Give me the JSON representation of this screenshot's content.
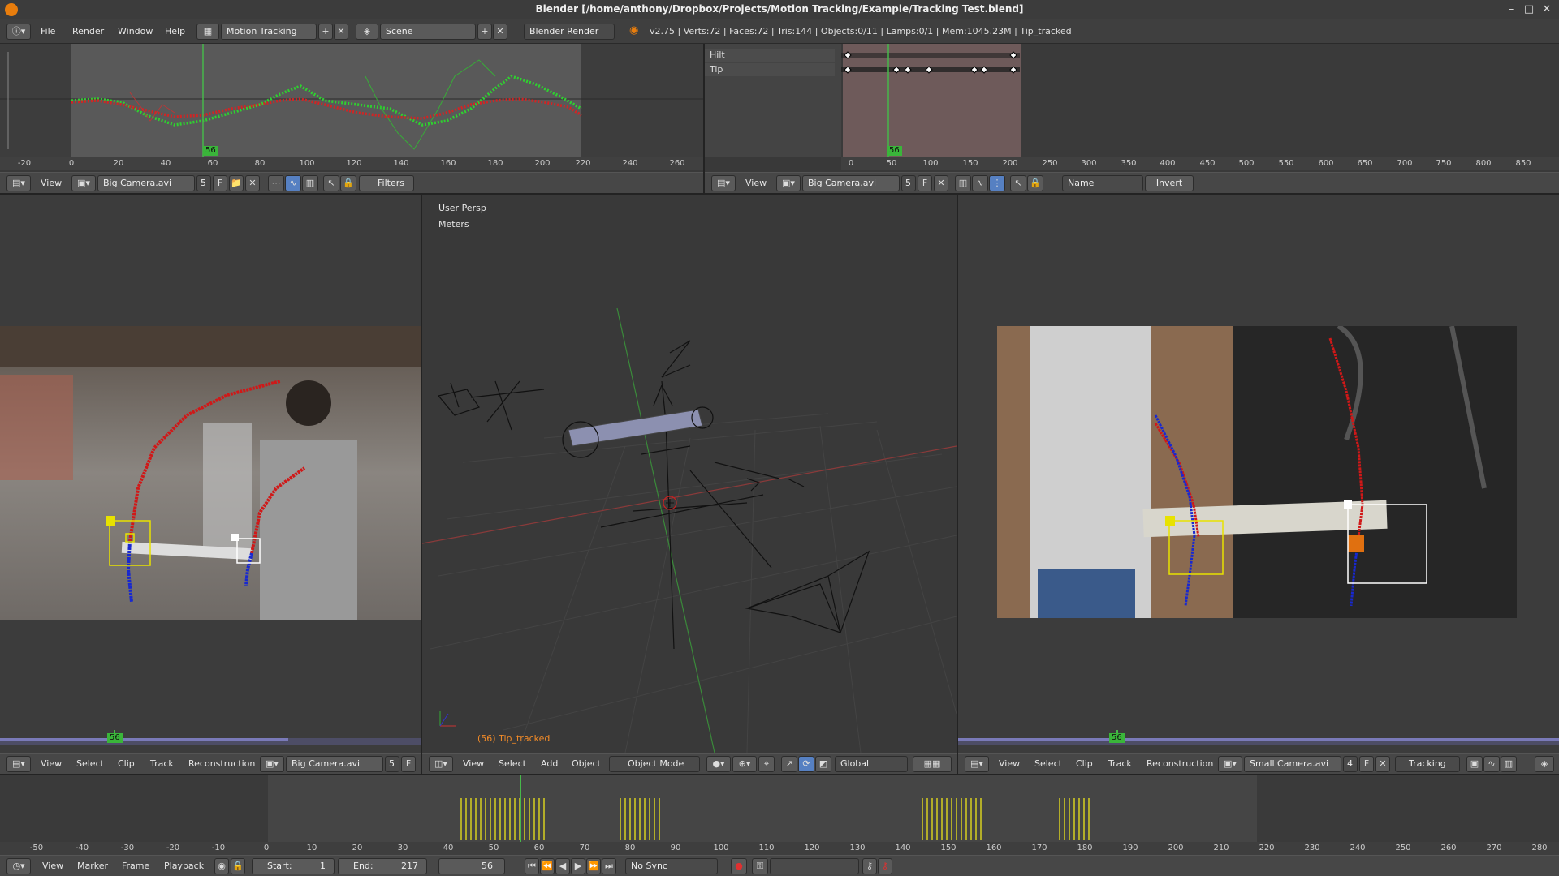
{
  "window": {
    "title": "Blender [/home/anthony/Dropbox/Projects/Motion Tracking/Example/Tracking Test.blend]",
    "minimize": "–",
    "maximize": "□",
    "close": "✕"
  },
  "info_bar": {
    "menus": [
      "File",
      "Render",
      "Window",
      "Help"
    ],
    "screen_layout": "Motion Tracking",
    "scene": "Scene",
    "render_engine": "Blender Render",
    "stats": "v2.75 | Verts:72 | Faces:72 | Tris:144 | Objects:0/11 | Lamps:0/1 | Mem:1045.23M | Tip_tracked"
  },
  "graph_editor": {
    "ruler_ticks": [
      "-20",
      "0",
      "20",
      "40",
      "60",
      "80",
      "100",
      "120",
      "140",
      "160",
      "180",
      "200",
      "220",
      "240",
      "260"
    ],
    "current_frame": "56",
    "header": {
      "view": "View",
      "clip": "Big Camera.avi",
      "users": "5",
      "f": "F",
      "filters": "Filters"
    }
  },
  "dopesheet": {
    "channels": [
      "Hilt",
      "Tip"
    ],
    "ruler_ticks": [
      "0",
      "50",
      "100",
      "150",
      "200",
      "250",
      "300",
      "350",
      "400",
      "450",
      "500",
      "550",
      "600",
      "650",
      "700",
      "750",
      "800",
      "850"
    ],
    "current_frame": "56",
    "header": {
      "view": "View",
      "clip": "Big Camera.avi",
      "users": "5",
      "f": "F",
      "sort": "Name",
      "invert": "Invert"
    }
  },
  "clip_left": {
    "current_frame": "56",
    "header": {
      "menus": [
        "View",
        "Select",
        "Clip",
        "Track",
        "Reconstruction"
      ],
      "clip": "Big Camera.avi",
      "users": "5",
      "f": "F"
    }
  },
  "viewport": {
    "overlay_persp": "User Persp",
    "overlay_units": "Meters",
    "object_label": "(56) Tip_tracked",
    "header": {
      "menus": [
        "View",
        "Select",
        "Add",
        "Object"
      ],
      "mode": "Object Mode",
      "orientation": "Global"
    }
  },
  "clip_right": {
    "current_frame": "56",
    "header": {
      "menus": [
        "View",
        "Select",
        "Clip",
        "Track",
        "Reconstruction"
      ],
      "clip": "Small Camera.avi",
      "users": "4",
      "f": "F",
      "mode": "Tracking"
    }
  },
  "timeline": {
    "ruler_ticks": [
      "-50",
      "-40",
      "-30",
      "-20",
      "-10",
      "0",
      "10",
      "20",
      "30",
      "40",
      "50",
      "60",
      "70",
      "80",
      "90",
      "100",
      "110",
      "120",
      "130",
      "140",
      "150",
      "160",
      "170",
      "180",
      "190",
      "200",
      "210",
      "220",
      "230",
      "240",
      "250",
      "260",
      "270",
      "280"
    ],
    "header": {
      "menus": [
        "View",
        "Marker",
        "Frame",
        "Playback"
      ],
      "start": "Start:",
      "start_val": "1",
      "end": "End:",
      "end_val": "217",
      "current": "56",
      "sync": "No Sync"
    }
  },
  "colors": {
    "accent": "#5680c2",
    "frame_green": "#47b84a",
    "track_red": "#cc2020",
    "track_blue": "#2030d0",
    "marker_yellow": "#e8e200"
  }
}
